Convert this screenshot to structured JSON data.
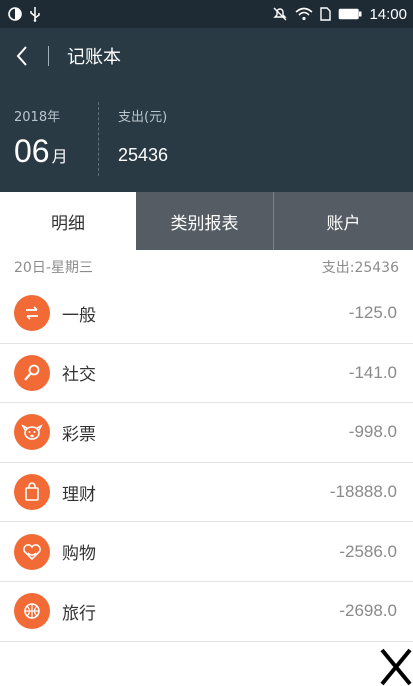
{
  "status_bar": {
    "time": "14:00"
  },
  "app_bar": {
    "title": "记账本"
  },
  "summary": {
    "year_label": "2018年",
    "month_number": "06",
    "month_unit": "月",
    "expense_label": "支出(元)",
    "expense_value": "25436"
  },
  "tabs": [
    {
      "label": "明细",
      "active": true
    },
    {
      "label": "类别报表",
      "active": false
    },
    {
      "label": "账户",
      "active": false
    }
  ],
  "day_header": {
    "date": "20日-星期三",
    "total": "支出:25436"
  },
  "entries": [
    {
      "name": "一般",
      "amount": "-125.0",
      "icon": "exchange-icon"
    },
    {
      "name": "社交",
      "amount": "-141.0",
      "icon": "microphone-icon"
    },
    {
      "name": "彩票",
      "amount": "-998.0",
      "icon": "dog-face-icon"
    },
    {
      "name": "理财",
      "amount": "-18888.0",
      "icon": "shopping-bag-icon"
    },
    {
      "name": "购物",
      "amount": "-2586.0",
      "icon": "heart-icon"
    },
    {
      "name": "旅行",
      "amount": "-2698.0",
      "icon": "ball-icon"
    }
  ],
  "colors": {
    "header_bg": "#2a3a45",
    "status_bg": "#1e2b34",
    "accent": "#f26a35",
    "tab_inactive_bg": "#555c64"
  }
}
